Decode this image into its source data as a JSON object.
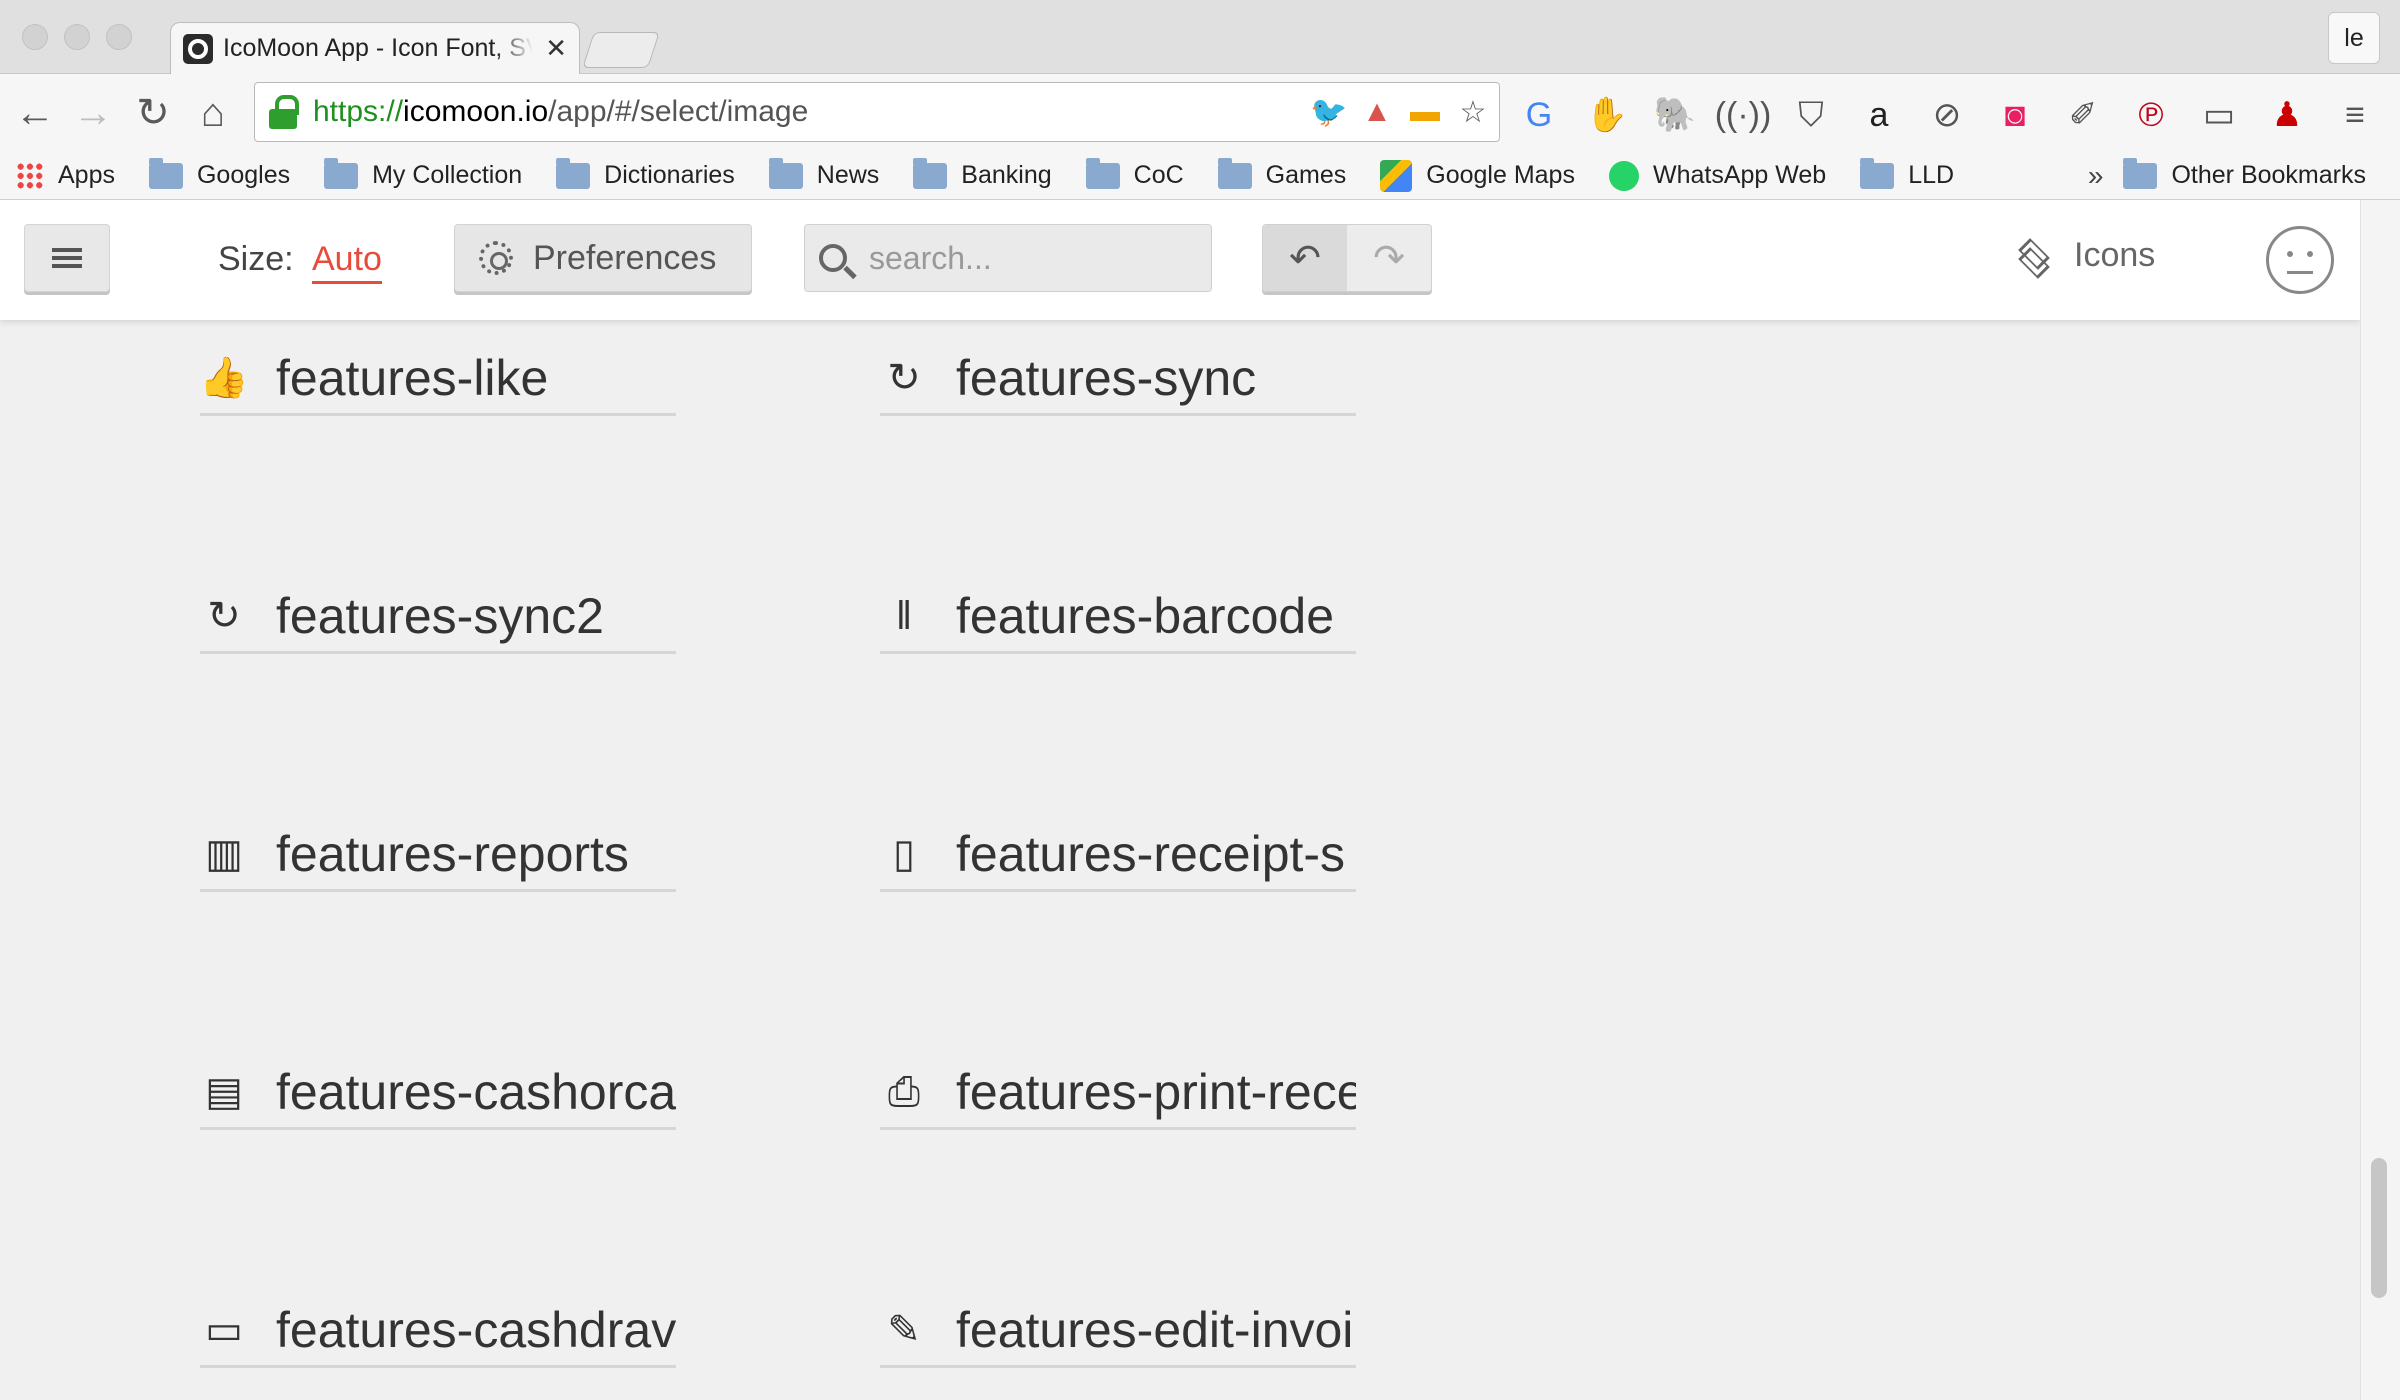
{
  "browser": {
    "tab_title": "IcoMoon App - Icon Font, SVG, PDF & PNG Generator",
    "profile": "le",
    "url_scheme": "https://",
    "url_host": "icomoon.io",
    "url_path": "/app/#/select/image",
    "bookmarks": [
      {
        "label": "Apps",
        "icon": "apps-grid-icon"
      },
      {
        "label": "Googles",
        "icon": "folder-icon"
      },
      {
        "label": "My Collection",
        "icon": "folder-icon"
      },
      {
        "label": "Dictionaries",
        "icon": "folder-icon"
      },
      {
        "label": "News",
        "icon": "folder-icon"
      },
      {
        "label": "Banking",
        "icon": "folder-icon"
      },
      {
        "label": "CoC",
        "icon": "folder-icon"
      },
      {
        "label": "Games",
        "icon": "folder-icon"
      },
      {
        "label": "Google Maps",
        "icon": "google-maps-icon"
      },
      {
        "label": "WhatsApp Web",
        "icon": "whatsapp-icon"
      },
      {
        "label": "LLD",
        "icon": "folder-icon"
      }
    ],
    "overflow": "»",
    "other_bookmarks": "Other Bookmarks"
  },
  "app": {
    "size_label": "Size:",
    "size_value": "Auto",
    "preferences_label": "Preferences",
    "search_placeholder": "search...",
    "icons_label": "Icons"
  },
  "icons": [
    {
      "name": "features-like",
      "glyph": "👍"
    },
    {
      "name": "features-sync",
      "glyph": "↻"
    },
    {
      "name": "features-sync2",
      "glyph": "↻"
    },
    {
      "name": "features-barcode",
      "glyph": "‖"
    },
    {
      "name": "features-reports",
      "glyph": "▥"
    },
    {
      "name": "features-receipt-s",
      "glyph": "▯"
    },
    {
      "name": "features-cashorca",
      "glyph": "▤"
    },
    {
      "name": "features-print-rece",
      "glyph": "⎙"
    },
    {
      "name": "features-cashdrav",
      "glyph": "▭"
    },
    {
      "name": "features-edit-invoi",
      "glyph": "✎"
    }
  ],
  "colors": {
    "accent": "#e84b3a",
    "secure_green": "#1f8f1f"
  }
}
